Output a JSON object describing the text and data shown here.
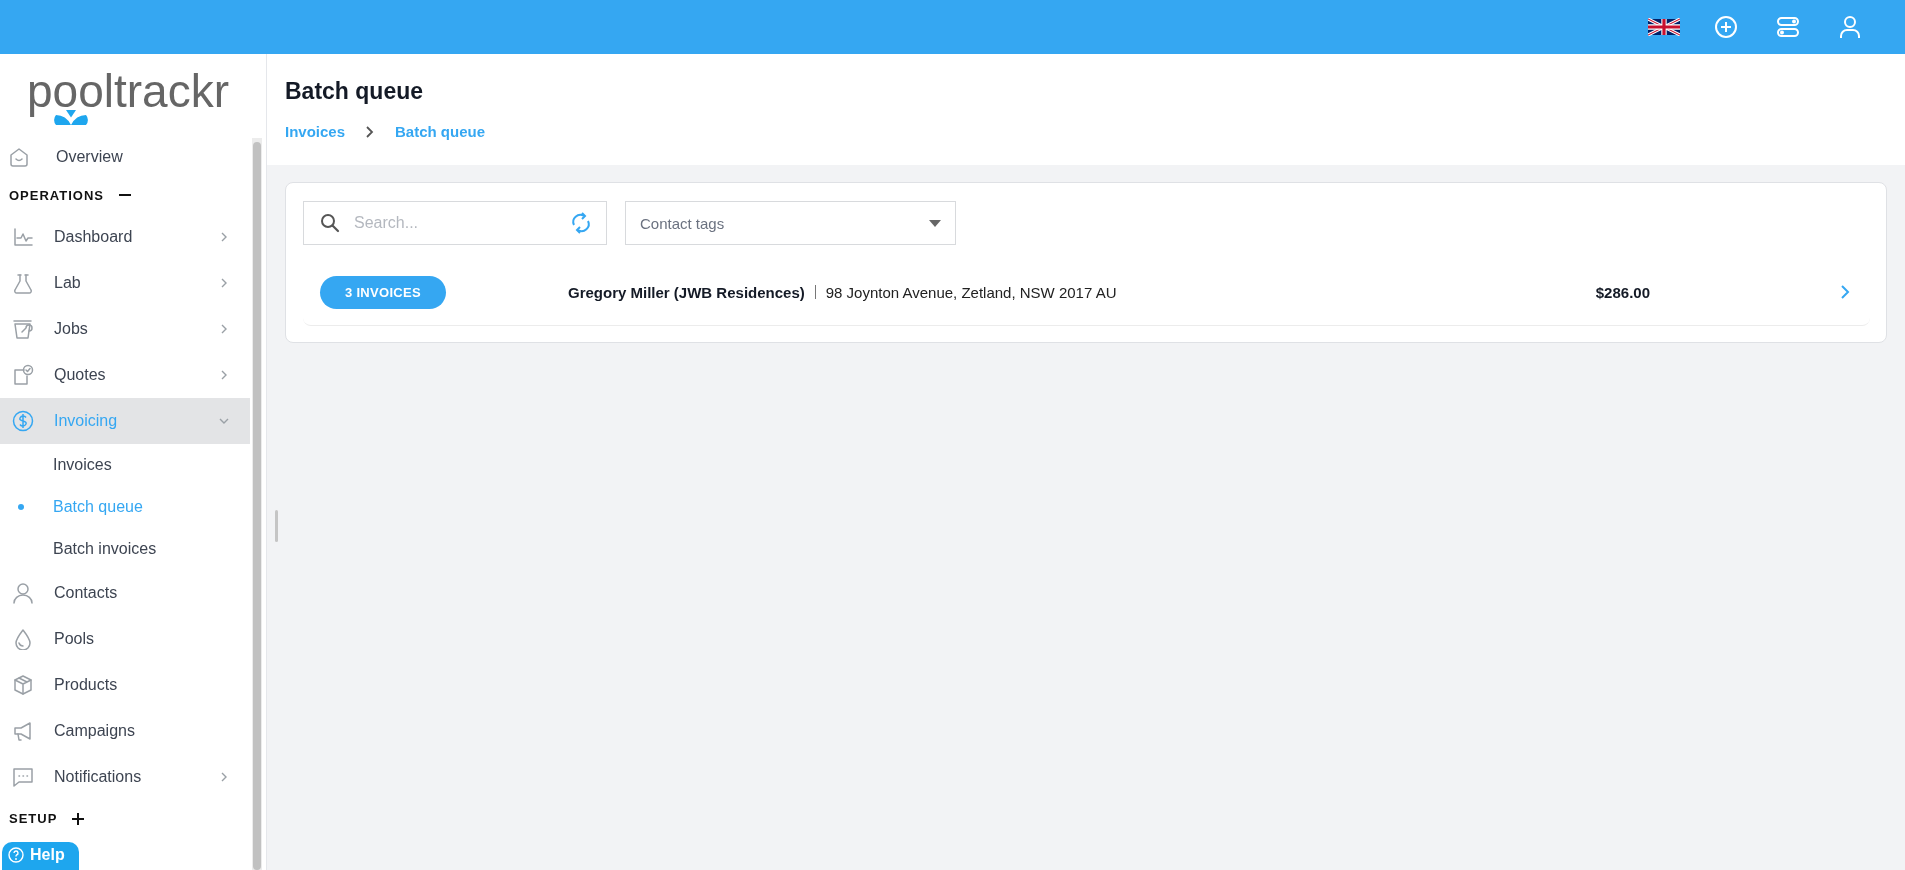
{
  "logo": {
    "text": "pooltrackr"
  },
  "sidebar": {
    "items": [
      {
        "kind": "item",
        "label": "Overview",
        "selected": false
      },
      {
        "kind": "header",
        "label": "OPERATIONS",
        "expanded": true
      },
      {
        "kind": "item",
        "label": "Dashboard",
        "selected": false,
        "expanded": false
      },
      {
        "kind": "item",
        "label": "Lab",
        "selected": false,
        "expanded": false
      },
      {
        "kind": "item",
        "label": "Jobs",
        "selected": false,
        "expanded": false
      },
      {
        "kind": "item",
        "label": "Quotes",
        "selected": false,
        "expanded": false
      },
      {
        "kind": "item",
        "label": "Invoicing",
        "selected": true,
        "expanded": true,
        "children": [
          {
            "label": "Invoices",
            "selected": false
          },
          {
            "label": "Batch queue",
            "selected": true
          },
          {
            "label": "Batch invoices",
            "selected": false
          }
        ]
      },
      {
        "kind": "item",
        "label": "Contacts",
        "selected": false
      },
      {
        "kind": "item",
        "label": "Pools",
        "selected": false
      },
      {
        "kind": "item",
        "label": "Products",
        "selected": false
      },
      {
        "kind": "item",
        "label": "Campaigns",
        "selected": false
      },
      {
        "kind": "item",
        "label": "Notifications",
        "selected": false,
        "expanded": false
      },
      {
        "kind": "header",
        "label": "SETUP",
        "expanded": false
      }
    ]
  },
  "help_button": {
    "label": "Help"
  },
  "page": {
    "title": "Batch queue",
    "breadcrumb": [
      "Invoices",
      "Batch queue"
    ]
  },
  "filters": {
    "search": {
      "placeholder": "Search..."
    },
    "contact_tags": {
      "placeholder": "Contact tags"
    }
  },
  "rows": [
    {
      "badge": "3 INVOICES",
      "contact": "Gregory Miller (JWB Residences)",
      "address": "98 Joynton Avenue, Zetland, NSW 2017 AU",
      "amount": "$286.00"
    }
  ]
}
